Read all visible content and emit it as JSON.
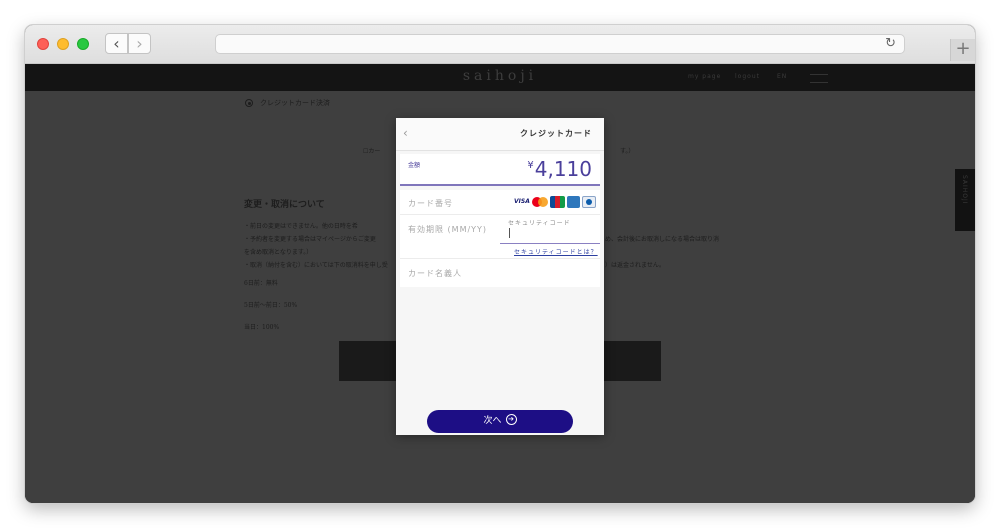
{
  "browser": {
    "back_glyph": "‹",
    "forward_glyph": "›",
    "reload_glyph": "↻",
    "new_tab_glyph": "+"
  },
  "site": {
    "logo": "saihoji",
    "nav": [
      "my page",
      "logout",
      "EN"
    ],
    "payment_option": "クレジットカード決済",
    "checkbox_text": "☐カー",
    "checkbox_text_right": "す。）",
    "section_heading": "変更・取消について",
    "policy_lines": [
      "・前日の変更はできません。他の日時を希",
      "・予約者を変更する場合はマイページからご変更",
      "を含め取消となります。）",
      "・取消（納付を含む）においては下の取消料を申し受",
      "6日前：無料",
      "5日前〜前日：50%",
      "当日：100%"
    ],
    "policy_right_1": "め、会計後にお取消しになる場合は取り消",
    "policy_right_2": "）は返金されません。",
    "side_tab_label": "SAIHOJI"
  },
  "modal": {
    "back_glyph": "‹",
    "title": "クレジットカード",
    "amount_label": "金額",
    "currency_symbol": "¥",
    "amount_value": "4,110",
    "card_number_label": "カード番号",
    "card_brands": [
      "VISA",
      "Mastercard",
      "JCB",
      "American Express",
      "Diners Club"
    ],
    "visa_text": "VISA",
    "expiry_label": "有効期限 (MM/YY)",
    "security_code_label": "セキュリティコード",
    "security_link": "セキュリティコードとは？",
    "cardholder_label": "カード名義人",
    "next_button": "次へ",
    "next_arrow_glyph": "➔"
  },
  "colors": {
    "accent": "#4a3f9b",
    "next_button": "#1d0e85",
    "overlay": "#3f3f3f"
  }
}
